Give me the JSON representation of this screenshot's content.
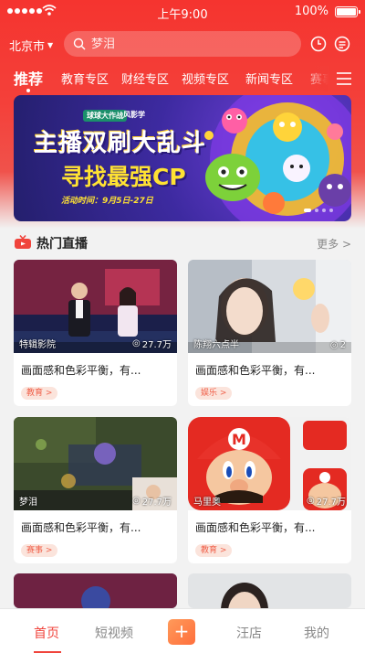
{
  "status_bar": {
    "time": "上午9:00",
    "battery": "100%"
  },
  "header": {
    "city": "北京市",
    "search_placeholder": "梦泪"
  },
  "tabs": [
    "推荐",
    "教育专区",
    "财经专区",
    "视频专区",
    "新闻专区",
    "赛事"
  ],
  "banner": {
    "brand_left": "球球大作战",
    "brand_right": "风影学",
    "line1": "主播双刷大乱斗",
    "line2": "寻找最强CP",
    "date": "活动时间：9月5日-27日"
  },
  "section": {
    "title": "热门直播",
    "more": "更多 >"
  },
  "cards": [
    {
      "name": "特辑影院",
      "views": "27.7万",
      "title": "画面感和色彩平衡，有...",
      "tag": "教育 >"
    },
    {
      "name": "陈翔六点半",
      "views": "2",
      "title": "画面感和色彩平衡，有...",
      "tag": "娱乐 >"
    },
    {
      "name": "梦泪",
      "views": "27.7万",
      "title": "画面感和色彩平衡，有...",
      "tag": "赛事 >"
    },
    {
      "name": "马里奥",
      "views": "27.7万",
      "title": "画面感和色彩平衡，有...",
      "tag": "教育 >"
    }
  ],
  "bottom_nav": {
    "home": "首页",
    "short_video": "短视频",
    "plus": "+",
    "shop": "汪店",
    "mine": "我的"
  },
  "colors": {
    "brand_red": "#f0443c",
    "tag_bg": "#fbe4dc",
    "tag_text": "#f0604a"
  }
}
